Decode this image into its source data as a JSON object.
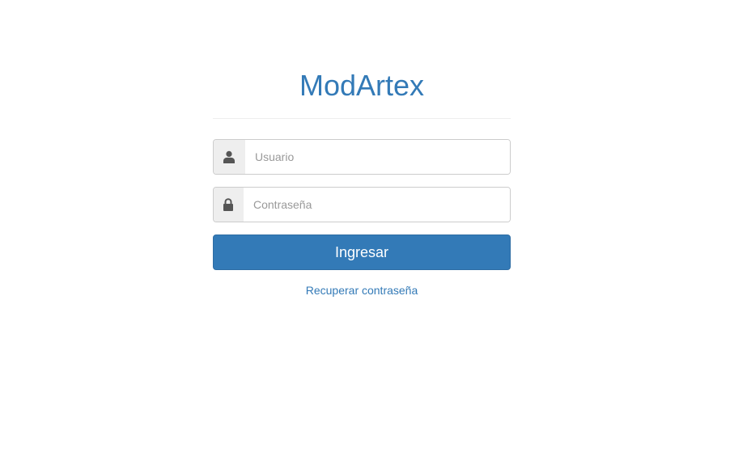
{
  "brand": {
    "title": "ModArtex"
  },
  "login_form": {
    "username": {
      "icon": "user-icon",
      "value": "",
      "placeholder": "Usuario"
    },
    "password": {
      "icon": "lock-icon",
      "value": "",
      "placeholder": "Contraseña"
    },
    "submit_label": "Ingresar",
    "recover_label": "Recuperar contraseña"
  },
  "colors": {
    "accent": "#337ab7",
    "addon_background": "#eeeeee",
    "icon": "#555555",
    "field_border": "#cccccc"
  }
}
